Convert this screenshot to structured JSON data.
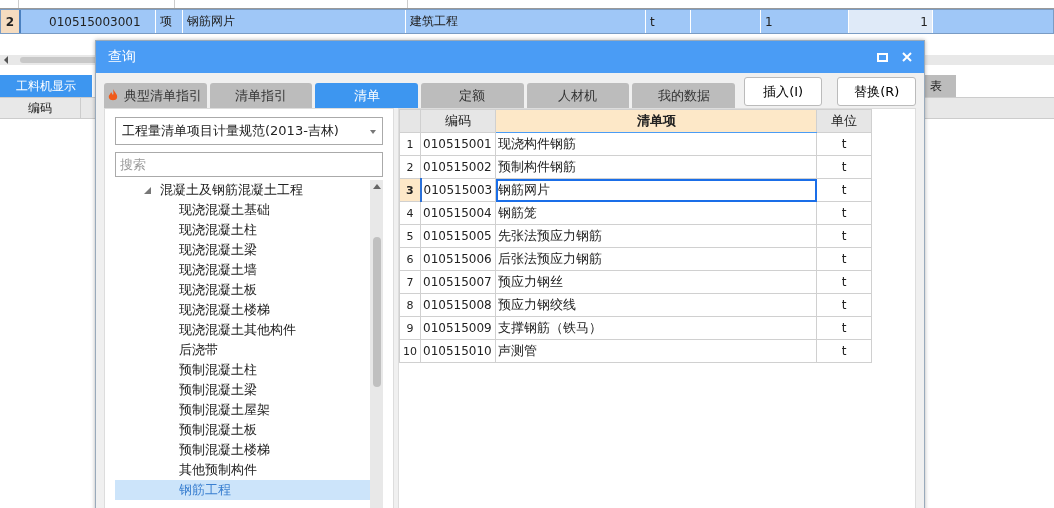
{
  "background": {
    "grid_row": {
      "number": "2",
      "selected": true,
      "cells": [
        "010515003001",
        "项",
        "钢筋网片",
        "建筑工程",
        "t",
        "",
        "1",
        "1"
      ]
    },
    "tabs": [
      {
        "label": "工料机显示",
        "selected": true
      },
      {
        "label": "表",
        "selected": false
      }
    ],
    "header": [
      "编码"
    ]
  },
  "dialog": {
    "title": "查询",
    "tabs": [
      {
        "label": "典型清单指引",
        "selected": false,
        "kind": "featured"
      },
      {
        "label": "清单指引",
        "selected": false,
        "kind": "plain"
      },
      {
        "label": "清单",
        "selected": true,
        "kind": "plain"
      },
      {
        "label": "定额",
        "selected": false,
        "kind": "plain"
      },
      {
        "label": "人材机",
        "selected": false,
        "kind": "plain"
      },
      {
        "label": "我的数据",
        "selected": false,
        "kind": "plain"
      }
    ],
    "buttons": [
      "插入(I)",
      "替换(R)"
    ],
    "library_dropdown": {
      "value": "工程量清单项目计量规范(2013-吉林)"
    },
    "search": {
      "placeholder": "搜索"
    },
    "tree": [
      {
        "label": "混凝土及钢筋混凝土工程",
        "expanded": true,
        "selected": false,
        "children": [
          {
            "label": "现浇混凝土基础",
            "selected": false
          },
          {
            "label": "现浇混凝土柱",
            "selected": false
          },
          {
            "label": "现浇混凝土梁",
            "selected": false
          },
          {
            "label": "现浇混凝土墙",
            "selected": false
          },
          {
            "label": "现浇混凝土板",
            "selected": false
          },
          {
            "label": "现浇混凝土楼梯",
            "selected": false
          },
          {
            "label": "现浇混凝土其他构件",
            "selected": false
          },
          {
            "label": "后浇带",
            "selected": false
          },
          {
            "label": "预制混凝土柱",
            "selected": false
          },
          {
            "label": "预制混凝土梁",
            "selected": false
          },
          {
            "label": "预制混凝土屋架",
            "selected": false
          },
          {
            "label": "预制混凝土板",
            "selected": false
          },
          {
            "label": "预制混凝土楼梯",
            "selected": false
          },
          {
            "label": "其他预制构件",
            "selected": false
          },
          {
            "label": "钢筋工程",
            "selected": true
          }
        ]
      }
    ],
    "table": {
      "columns": [
        "编码",
        "清单项",
        "单位"
      ],
      "rows": [
        {
          "number": "1",
          "code": "010515001",
          "name": "现浇构件钢筋",
          "unit": "t",
          "selected": false
        },
        {
          "number": "2",
          "code": "010515002",
          "name": "预制构件钢筋",
          "unit": "t",
          "selected": false
        },
        {
          "number": "3",
          "code": "010515003",
          "name": "钢筋网片",
          "unit": "t",
          "selected": true
        },
        {
          "number": "4",
          "code": "010515004",
          "name": "钢筋笼",
          "unit": "t",
          "selected": false
        },
        {
          "number": "5",
          "code": "010515005",
          "name": "先张法预应力钢筋",
          "unit": "t",
          "selected": false
        },
        {
          "number": "6",
          "code": "010515006",
          "name": "后张法预应力钢筋",
          "unit": "t",
          "selected": false
        },
        {
          "number": "7",
          "code": "010515007",
          "name": "预应力钢丝",
          "unit": "t",
          "selected": false
        },
        {
          "number": "8",
          "code": "010515008",
          "name": "预应力钢绞线",
          "unit": "t",
          "selected": false
        },
        {
          "number": "9",
          "code": "010515009",
          "name": "支撑钢筋（铁马）",
          "unit": "t",
          "selected": false
        },
        {
          "number": "10",
          "code": "010515010",
          "name": "声测管",
          "unit": "t",
          "selected": false
        }
      ]
    }
  }
}
